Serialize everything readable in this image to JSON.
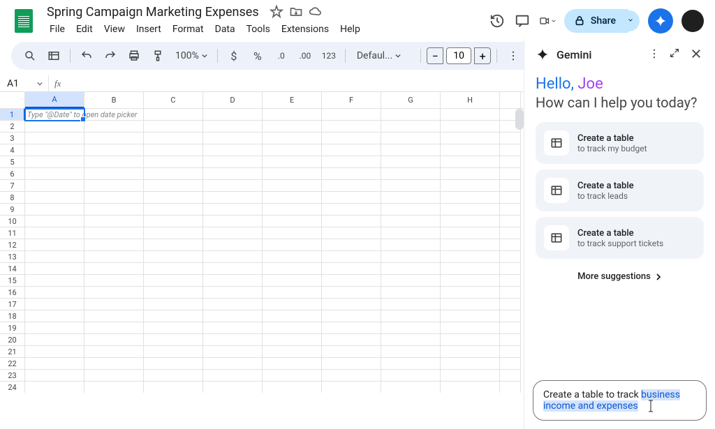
{
  "doc": {
    "title": "Spring Campaign Marketing Expenses"
  },
  "menu": {
    "file": "File",
    "edit": "Edit",
    "view": "View",
    "insert": "Insert",
    "format": "Format",
    "data": "Data",
    "tools": "Tools",
    "extensions": "Extensions",
    "help": "Help"
  },
  "share": {
    "label": "Share"
  },
  "toolbar": {
    "zoom": "100%",
    "font": "Defaul...",
    "font_size": "10",
    "currency": "$",
    "percent": "%",
    "decrease_decimal": ".0",
    "increase_decimal": ".00",
    "number_format": "123"
  },
  "namebox": {
    "value": "A1"
  },
  "fx": {
    "label": "fx"
  },
  "columns": [
    "A",
    "B",
    "C",
    "D",
    "E",
    "F",
    "G",
    "H"
  ],
  "rows_count": 24,
  "cell_placeholder": "Type \"@Date\" to open date picker",
  "gemini": {
    "title": "Gemini",
    "hello": "Hello,",
    "user": "Joe",
    "subtitle": "How can I help you today?",
    "suggestions": [
      {
        "title": "Create a table",
        "desc": "to track my budget"
      },
      {
        "title": "Create a table",
        "desc": "to track leads"
      },
      {
        "title": "Create a table",
        "desc": "to track support tickets"
      }
    ],
    "more": "More suggestions",
    "input_pre": "Create a table to track ",
    "input_highlight1": "business",
    "input_highlight2": "income and expenses"
  }
}
